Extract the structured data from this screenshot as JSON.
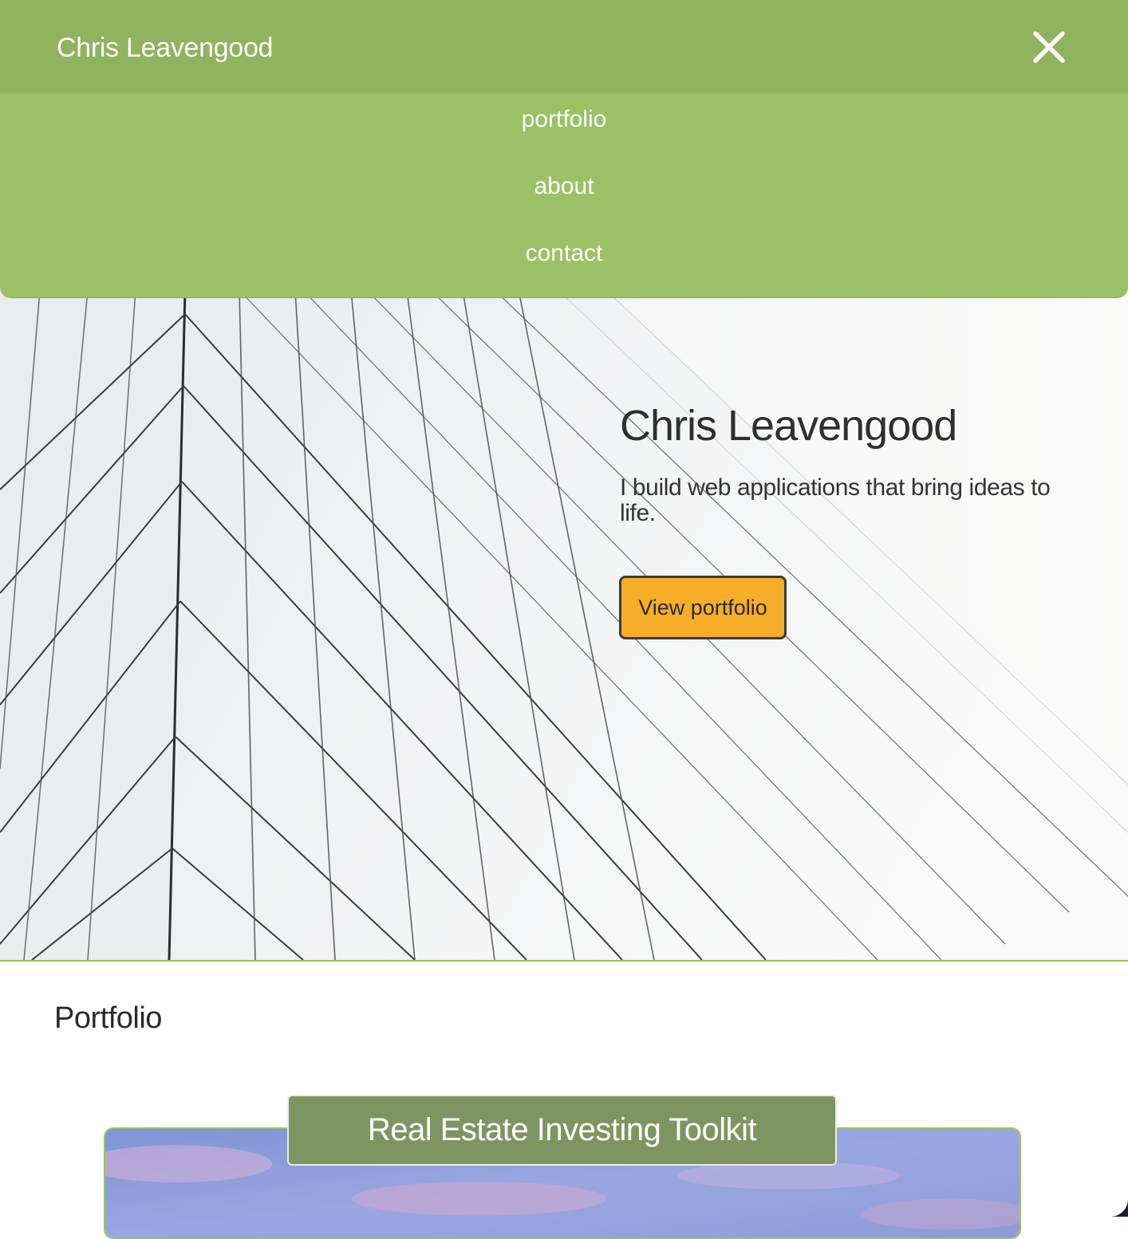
{
  "nav": {
    "brand": "Chris Leavengood",
    "close_icon": "close-icon",
    "links": [
      {
        "label": "portfolio"
      },
      {
        "label": "about"
      },
      {
        "label": "contact"
      }
    ]
  },
  "hero": {
    "title": "Chris Leavengood",
    "tagline": "I build web applications that bring ideas to life.",
    "cta_label": "View portfolio",
    "background_image": "glass-skyscraper-facade"
  },
  "portfolio": {
    "heading": "Portfolio",
    "projects": [
      {
        "title": "Real Estate Investing Toolkit",
        "image": "sky-clouds"
      }
    ]
  },
  "colors": {
    "nav_bar": "#8fb35e",
    "nav_menu": "#9ac165",
    "cta_background": "#f6ae29",
    "card_title_background": "#7e9562",
    "accent_border": "#9ac165"
  }
}
